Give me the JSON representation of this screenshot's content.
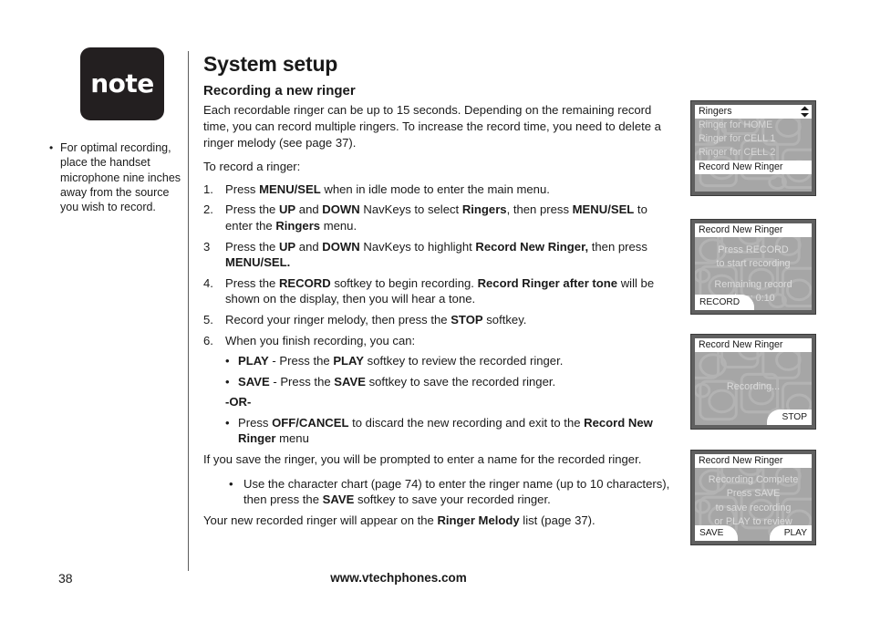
{
  "note": {
    "badge_label": "note",
    "bullet_marker": "•",
    "bullet_text": "For optimal recording, place the handset microphone nine inches away from the source you wish to record."
  },
  "main": {
    "page_title": "System setup",
    "section_title": "Recording a new ringer",
    "intro_paragraph": "Each recordable ringer can be up to 15 seconds. Depending on the remaining record time, you can record multiple ringers. To increase the record time, you need to delete a ringer melody (see page 37).",
    "steps_lead": "To record a ringer:",
    "steps": [
      {
        "num": "1.",
        "html": "Press <b>MENU/SEL</b> when in idle mode to enter the main menu."
      },
      {
        "num": "2.",
        "html": "Press the <b>UP</b> and <b>DOWN</b> NavKeys to select <b>Ringers</b>, then press <b>MENU/SEL</b> to enter the <b>Ringers</b> menu."
      },
      {
        "num": "3",
        "html": "Press the <b>UP</b> and <b>DOWN</b> NavKeys to highlight <b>Record New Ringer,</b> then press <b>MENU/SEL.</b>"
      },
      {
        "num": "4.",
        "html": "Press the <b>RECORD</b> softkey to begin recording. <b>Record Ringer after tone</b> will be shown on the display, then you will hear a tone."
      },
      {
        "num": "5.",
        "html": "Record your ringer melody, then press the <b>STOP</b> softkey."
      },
      {
        "num": "6.",
        "html": "When you finish recording, you can:"
      }
    ],
    "sub_bullets": [
      {
        "marker": "•",
        "html": "<b>PLAY</b> - Press the <b>PLAY</b> softkey to review the recorded ringer."
      },
      {
        "marker": "•",
        "html": "<b>SAVE</b> - Press the <b>SAVE</b> softkey to save the recorded ringer."
      }
    ],
    "or_label": "-OR-",
    "cancel_bullet": {
      "marker": "•",
      "html": "Press <b>OFF/CANCEL</b> to discard the new recording and exit to the <b>Record New Ringer</b> menu"
    },
    "save_paragraph": "If you save the ringer, you will be prompted to enter a name for the recorded ringer.",
    "charchart_bullet": {
      "marker": "•",
      "html": "Use the character chart (page 74) to enter the ringer name (up to 10 characters), then press the <b>SAVE</b> softkey to save your recorded ringer."
    },
    "closing_paragraph_html": "Your new recorded ringer will appear on the <b>Ringer Melody</b> list (page 37)."
  },
  "screens": [
    {
      "title": "Ringers",
      "scroll_icon": "updown-arrow-icon",
      "items": [
        {
          "label": "Ringer for HOME",
          "selected": false
        },
        {
          "label": "Ringer for CELL 1",
          "selected": false
        },
        {
          "label": "Ringer for CELL 2",
          "selected": false
        },
        {
          "label": "Record New Ringer",
          "selected": true
        }
      ]
    },
    {
      "title": "Record New Ringer",
      "lines": [
        "Press RECORD",
        "to start recording",
        "",
        "Remaining record",
        "time: 0:10"
      ],
      "softkey_left": "RECORD",
      "softkey_right": ""
    },
    {
      "title": "Record New Ringer",
      "lines": [
        "Recording..."
      ],
      "softkey_left": "",
      "softkey_right": "STOP"
    },
    {
      "title": "Record New Ringer",
      "lines": [
        "Recording Complete",
        "Press SAVE",
        "to save recording",
        "or PLAY to review"
      ],
      "softkey_left": "SAVE",
      "softkey_right": "PLAY"
    }
  ],
  "footer": {
    "page_number": "38",
    "url": "www.vtechphones.com"
  },
  "colors": {
    "lcd_bezel": "#606060",
    "lcd_screen": "#a6a6a6",
    "lcd_text": "#dcdcdc",
    "note_badge": "#231f20",
    "ink": "#1a1a1a"
  }
}
